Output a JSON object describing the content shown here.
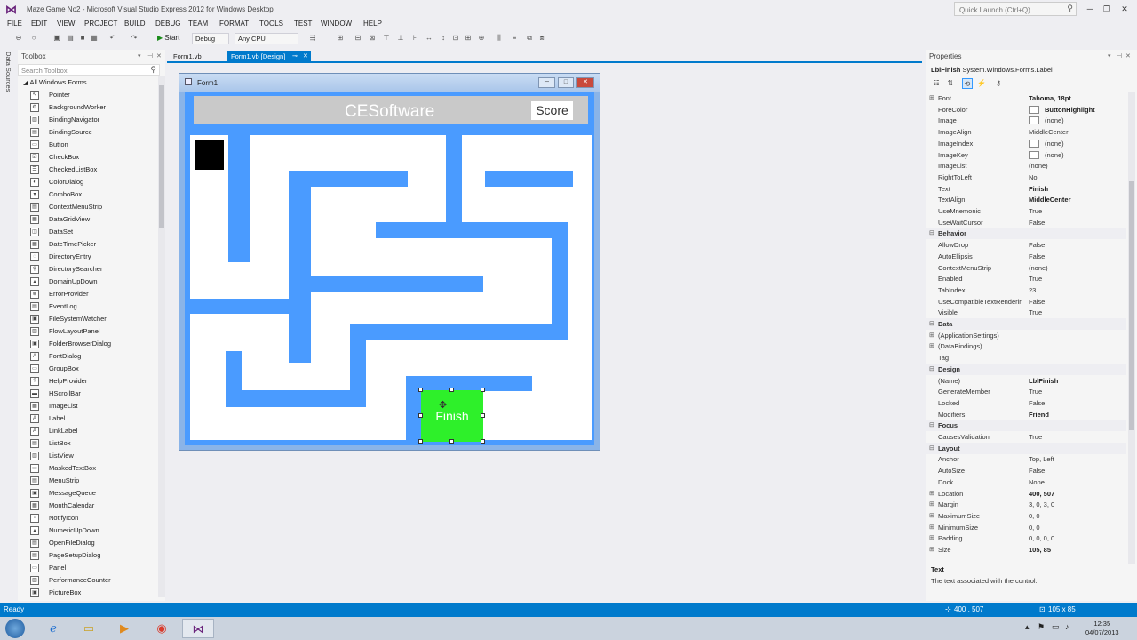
{
  "window": {
    "title": "Maze Game No2 - Microsoft Visual Studio Express 2012 for Windows Desktop",
    "quick_launch_placeholder": "Quick Launch (Ctrl+Q)"
  },
  "menu": [
    "FILE",
    "EDIT",
    "VIEW",
    "PROJECT",
    "BUILD",
    "DEBUG",
    "TEAM",
    "FORMAT",
    "TOOLS",
    "TEST",
    "WINDOW",
    "HELP"
  ],
  "toolbar": {
    "start_label": "Start",
    "config": "Debug",
    "platform": "Any CPU"
  },
  "side_tab": {
    "label": "Data Sources"
  },
  "toolbox": {
    "title": "Toolbox",
    "search_placeholder": "Search Toolbox",
    "group": "All Windows Forms",
    "items": [
      "Pointer",
      "BackgroundWorker",
      "BindingNavigator",
      "BindingSource",
      "Button",
      "CheckBox",
      "CheckedListBox",
      "ColorDialog",
      "ComboBox",
      "ContextMenuStrip",
      "DataGridView",
      "DataSet",
      "DateTimePicker",
      "DirectoryEntry",
      "DirectorySearcher",
      "DomainUpDown",
      "ErrorProvider",
      "EventLog",
      "FileSystemWatcher",
      "FlowLayoutPanel",
      "FolderBrowserDialog",
      "FontDialog",
      "GroupBox",
      "HelpProvider",
      "HScrollBar",
      "ImageList",
      "Label",
      "LinkLabel",
      "ListBox",
      "ListView",
      "MaskedTextBox",
      "MenuStrip",
      "MessageQueue",
      "MonthCalendar",
      "NotifyIcon",
      "NumericUpDown",
      "OpenFileDialog",
      "PageSetupDialog",
      "Panel",
      "PerformanceCounter",
      "PictureBox"
    ]
  },
  "doc_tabs": [
    {
      "label": "Form1.vb",
      "active": false
    },
    {
      "label": "Form1.vb [Design]",
      "active": true
    }
  ],
  "form": {
    "title": "Form1",
    "brand": "CESoftware",
    "score_label": "Score",
    "finish_label": "Finish",
    "wall_color": "#4a9bff",
    "finish_color": "#2ef02a"
  },
  "properties": {
    "title": "Properties",
    "object_name": "LblFinish",
    "object_type": "System.Windows.Forms.Label",
    "rows": [
      {
        "kind": "prop",
        "name": "Font",
        "value": "Tahoma, 18pt",
        "bold": true,
        "expand": true
      },
      {
        "kind": "prop",
        "name": "ForeColor",
        "value": "ButtonHighlight",
        "bold": true,
        "swatch": true
      },
      {
        "kind": "prop",
        "name": "Image",
        "value": "(none)",
        "swatch": true
      },
      {
        "kind": "prop",
        "name": "ImageAlign",
        "value": "MiddleCenter"
      },
      {
        "kind": "prop",
        "name": "ImageIndex",
        "value": "(none)",
        "swatch": true
      },
      {
        "kind": "prop",
        "name": "ImageKey",
        "value": "(none)",
        "swatch": true
      },
      {
        "kind": "prop",
        "name": "ImageList",
        "value": "(none)"
      },
      {
        "kind": "prop",
        "name": "RightToLeft",
        "value": "No"
      },
      {
        "kind": "prop",
        "name": "Text",
        "value": "Finish",
        "bold": true
      },
      {
        "kind": "prop",
        "name": "TextAlign",
        "value": "MiddleCenter",
        "bold": true
      },
      {
        "kind": "prop",
        "name": "UseMnemonic",
        "value": "True"
      },
      {
        "kind": "prop",
        "name": "UseWaitCursor",
        "value": "False"
      },
      {
        "kind": "cat",
        "name": "Behavior"
      },
      {
        "kind": "prop",
        "name": "AllowDrop",
        "value": "False"
      },
      {
        "kind": "prop",
        "name": "AutoEllipsis",
        "value": "False"
      },
      {
        "kind": "prop",
        "name": "ContextMenuStrip",
        "value": "(none)"
      },
      {
        "kind": "prop",
        "name": "Enabled",
        "value": "True"
      },
      {
        "kind": "prop",
        "name": "TabIndex",
        "value": "23"
      },
      {
        "kind": "prop",
        "name": "UseCompatibleTextRenderir",
        "value": "False"
      },
      {
        "kind": "prop",
        "name": "Visible",
        "value": "True"
      },
      {
        "kind": "cat",
        "name": "Data"
      },
      {
        "kind": "prop",
        "name": "(ApplicationSettings)",
        "value": "",
        "expand": true
      },
      {
        "kind": "prop",
        "name": "(DataBindings)",
        "value": "",
        "expand": true
      },
      {
        "kind": "prop",
        "name": "Tag",
        "value": ""
      },
      {
        "kind": "cat",
        "name": "Design"
      },
      {
        "kind": "prop",
        "name": "(Name)",
        "value": "LblFinish",
        "bold": true
      },
      {
        "kind": "prop",
        "name": "GenerateMember",
        "value": "True"
      },
      {
        "kind": "prop",
        "name": "Locked",
        "value": "False"
      },
      {
        "kind": "prop",
        "name": "Modifiers",
        "value": "Friend",
        "bold": true
      },
      {
        "kind": "cat",
        "name": "Focus"
      },
      {
        "kind": "prop",
        "name": "CausesValidation",
        "value": "True"
      },
      {
        "kind": "cat",
        "name": "Layout"
      },
      {
        "kind": "prop",
        "name": "Anchor",
        "value": "Top, Left"
      },
      {
        "kind": "prop",
        "name": "AutoSize",
        "value": "False"
      },
      {
        "kind": "prop",
        "name": "Dock",
        "value": "None"
      },
      {
        "kind": "prop",
        "name": "Location",
        "value": "400, 507",
        "bold": true,
        "expand": true
      },
      {
        "kind": "prop",
        "name": "Margin",
        "value": "3, 0, 3, 0",
        "expand": true
      },
      {
        "kind": "prop",
        "name": "MaximumSize",
        "value": "0, 0",
        "expand": true
      },
      {
        "kind": "prop",
        "name": "MinimumSize",
        "value": "0, 0",
        "expand": true
      },
      {
        "kind": "prop",
        "name": "Padding",
        "value": "0, 0, 0, 0",
        "expand": true
      },
      {
        "kind": "prop",
        "name": "Size",
        "value": "105, 85",
        "bold": true,
        "expand": true
      }
    ],
    "desc_title": "Text",
    "desc_text": "The text associated with the control."
  },
  "status": {
    "text": "Ready",
    "position": "400 , 507",
    "size": "105 x 85"
  },
  "clock": {
    "time": "12:35",
    "date": "04/07/2013"
  }
}
